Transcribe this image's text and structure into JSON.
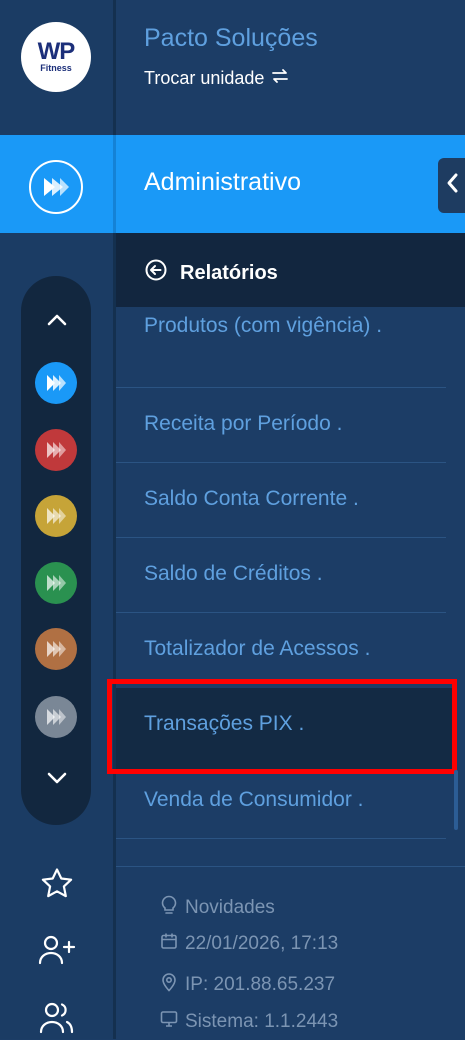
{
  "brand": {
    "logo_main": "WP",
    "logo_sub": "Fitness"
  },
  "header": {
    "title": "Pacto Soluções",
    "switch_label": "Trocar unidade"
  },
  "section": {
    "title": "Administrativo"
  },
  "submenu": {
    "back_label": "Relatórios"
  },
  "menu": {
    "items": [
      {
        "label": "Produtos (com vigência) ."
      },
      {
        "label": "Receita por Período ."
      },
      {
        "label": "Saldo Conta Corrente ."
      },
      {
        "label": "Saldo de Créditos ."
      },
      {
        "label": "Totalizador de Acessos ."
      },
      {
        "label": "Transações PIX ."
      },
      {
        "label": "Venda de Consumidor ."
      }
    ],
    "selected": "Transações PIX ."
  },
  "footer": {
    "news": "Novidades",
    "datetime": "22/01/2026, 17:13",
    "ip": "IP: 201.88.65.237",
    "system": "Sistema: 1.1.2443"
  },
  "icons": {
    "logo": "wp-fitness-logo",
    "switch": "swap-arrows-icon",
    "module": "pacto-play-icon",
    "collapse": "chevron-left-icon",
    "back": "arrow-left-circle-icon",
    "favorite": "star-icon",
    "add_user": "user-plus-icon",
    "users": "users-icon"
  },
  "colors": {
    "accent": "#1a99f7",
    "menu_text": "#5fa0df",
    "sidebar": "#1b3c64",
    "app_dots": [
      "#1a99f7",
      "#c0393b",
      "#c6a438",
      "#2a9150",
      "#b07043",
      "#7a8796"
    ],
    "highlight_border": "#ff0000"
  }
}
